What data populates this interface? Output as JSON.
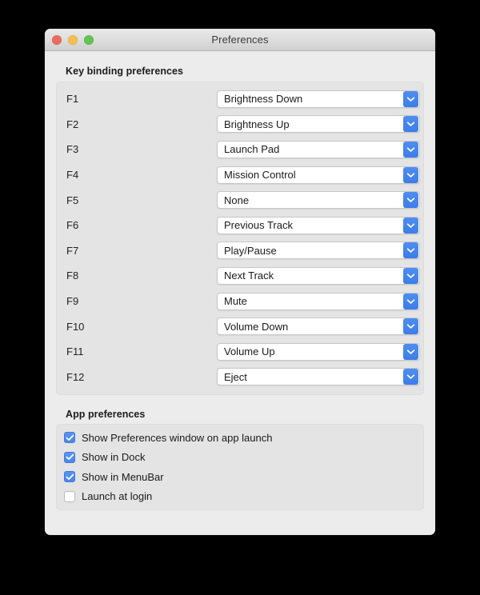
{
  "window": {
    "title": "Preferences",
    "traffic_lights": [
      {
        "name": "close",
        "color": "#ec6a5e"
      },
      {
        "name": "minimize",
        "color": "#f4bf4f"
      },
      {
        "name": "zoom",
        "color": "#61c454"
      }
    ]
  },
  "key_bindings": {
    "section_title": "Key binding preferences",
    "rows": [
      {
        "key": "F1",
        "value": "Brightness Down"
      },
      {
        "key": "F2",
        "value": "Brightness Up"
      },
      {
        "key": "F3",
        "value": "Launch Pad"
      },
      {
        "key": "F4",
        "value": "Mission Control"
      },
      {
        "key": "F5",
        "value": "None"
      },
      {
        "key": "F6",
        "value": "Previous Track"
      },
      {
        "key": "F7",
        "value": "Play/Pause"
      },
      {
        "key": "F8",
        "value": "Next Track"
      },
      {
        "key": "F9",
        "value": "Mute"
      },
      {
        "key": "F10",
        "value": "Volume Down"
      },
      {
        "key": "F11",
        "value": "Volume Up"
      },
      {
        "key": "F12",
        "value": "Eject"
      }
    ]
  },
  "app_preferences": {
    "section_title": "App preferences",
    "rows": [
      {
        "label": "Show Preferences window on app launch",
        "checked": true
      },
      {
        "label": "Show in Dock",
        "checked": true
      },
      {
        "label": "Show in MenuBar",
        "checked": true
      },
      {
        "label": "Launch at login",
        "checked": false
      }
    ]
  },
  "colors": {
    "accent_blue": "#4a85ee",
    "window_background": "#ececec",
    "panel_background": "#e4e4e4",
    "desktop_background": "#000000"
  },
  "icons": {
    "dropdown": "chevron-down-icon",
    "checkmark": "checkmark-icon"
  }
}
